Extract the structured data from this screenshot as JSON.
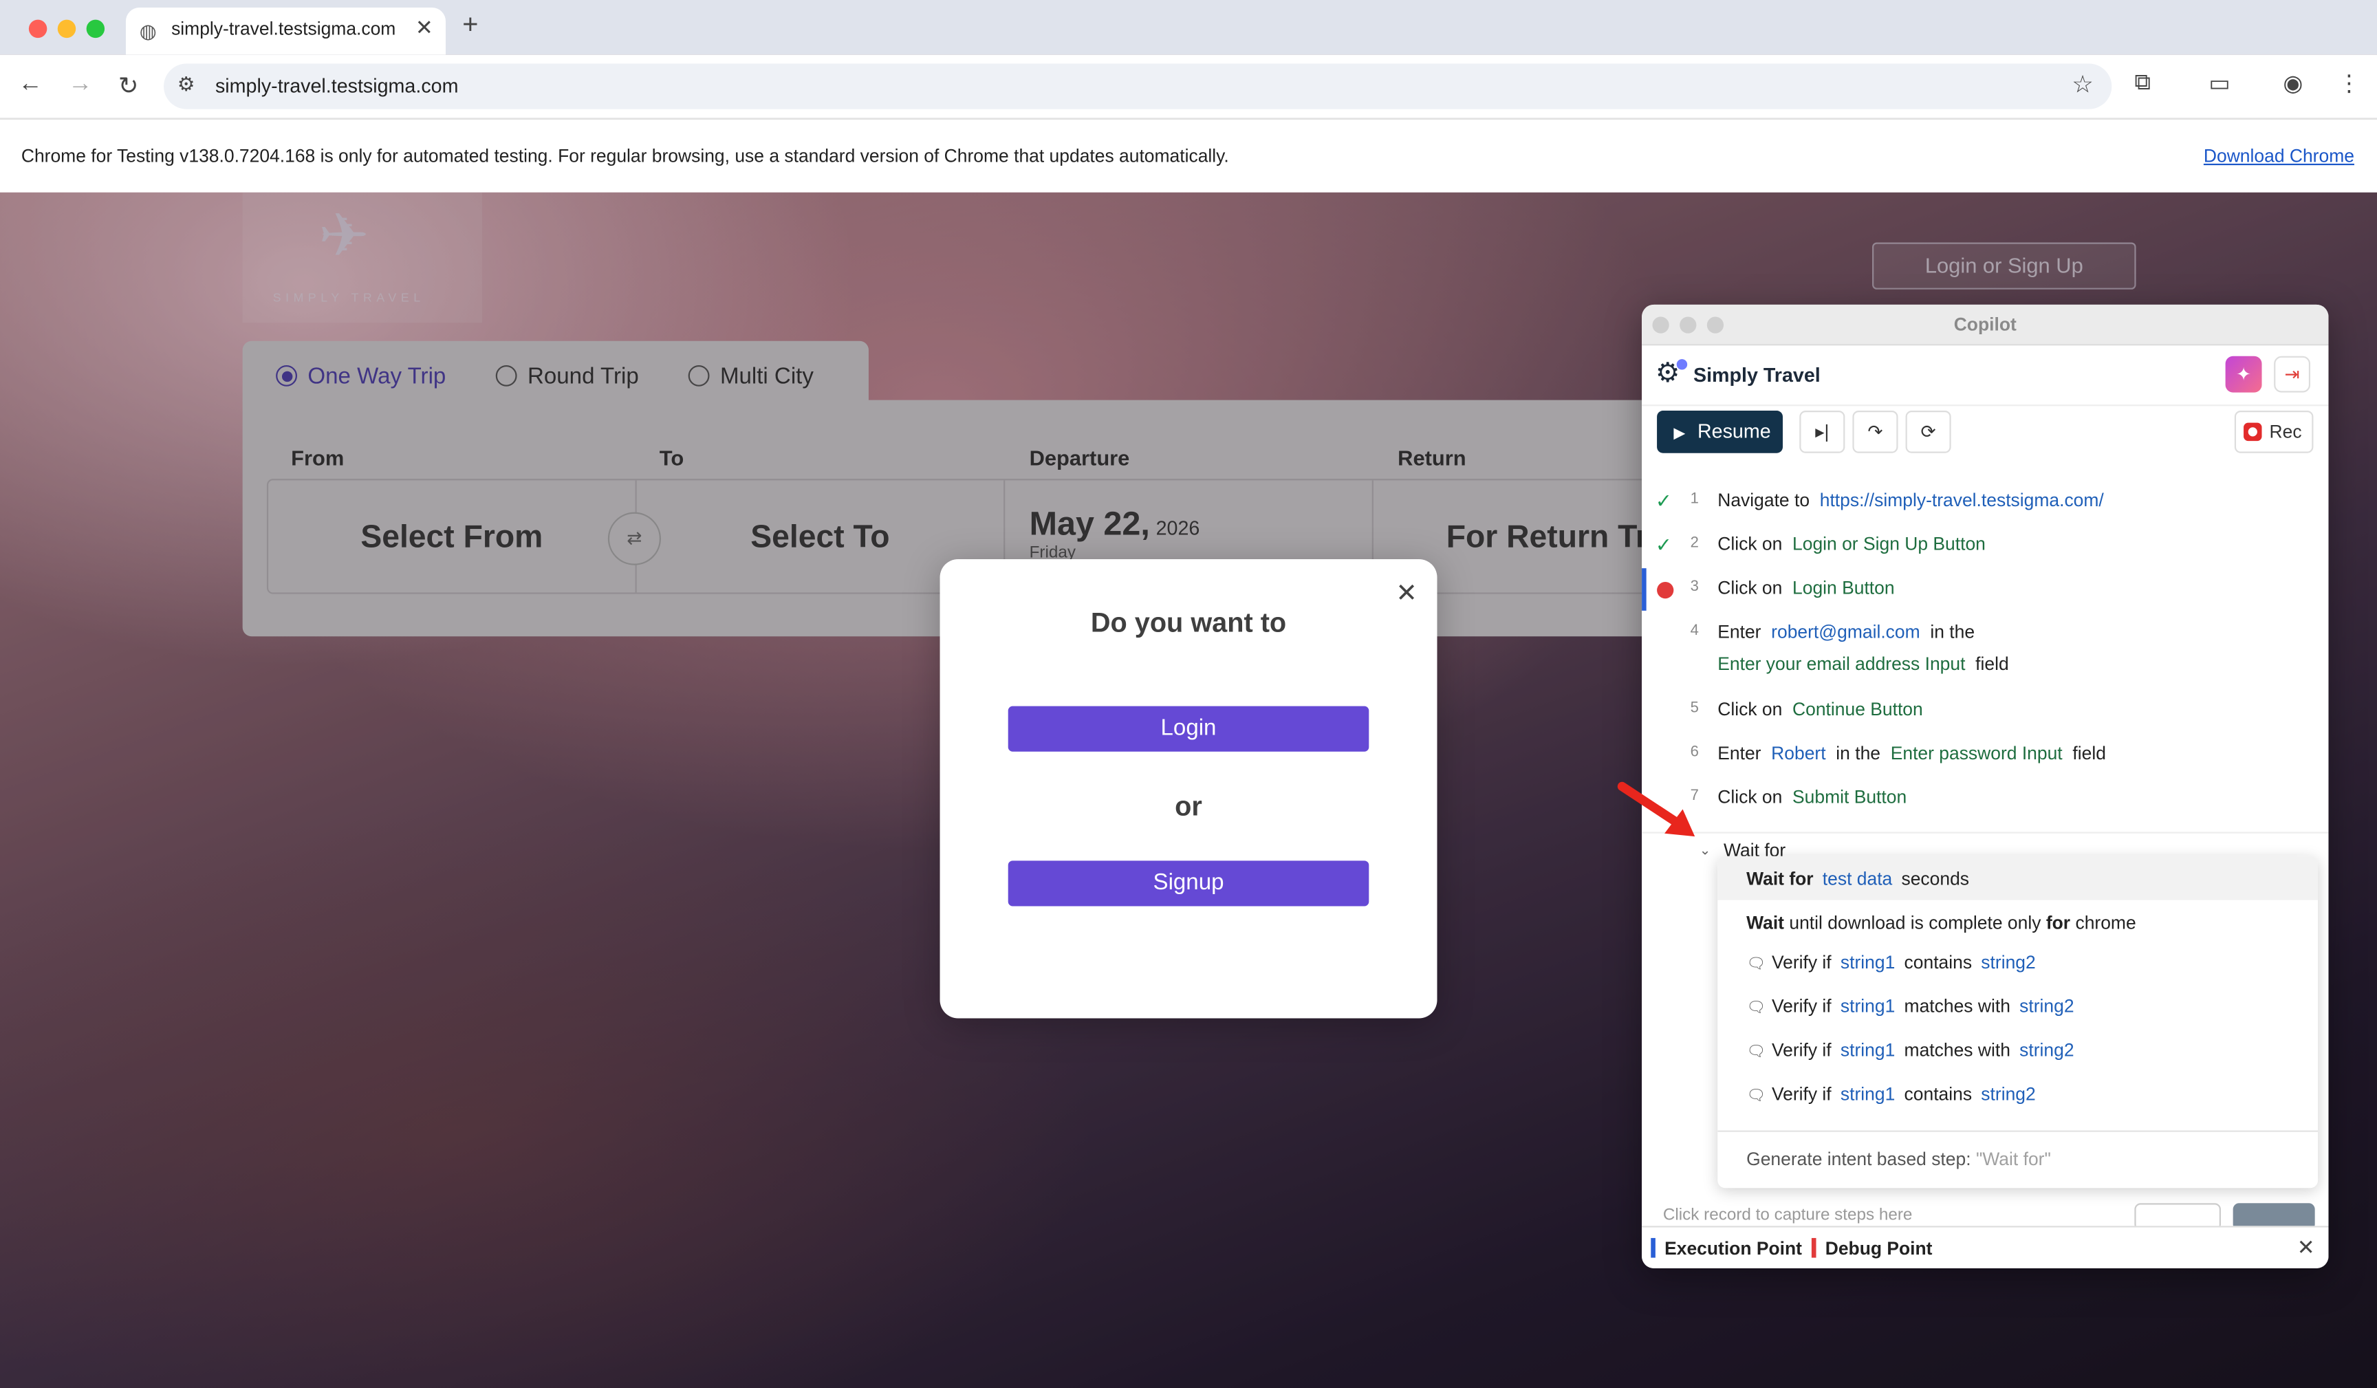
{
  "browser": {
    "tab_title": "simply-travel.testsigma.com",
    "url": "simply-travel.testsigma.com",
    "info_message": "Chrome for Testing v138.0.7204.168 is only for automated testing. For regular browsing, use a standard version of Chrome that updates automatically.",
    "download_link": "Download Chrome"
  },
  "site": {
    "logo_text": "SIMPLY TRAVEL",
    "header_button": "Login or Sign Up",
    "trip_types": [
      "One Way Trip",
      "Round Trip",
      "Multi City"
    ],
    "selected_trip": "One Way Trip",
    "labels": {
      "from": "From",
      "to": "To",
      "departure": "Departure",
      "return": "Return"
    },
    "from_value": "Select From",
    "to_value": "Select To",
    "departure_date": "May 22,",
    "departure_year": "2026",
    "departure_dow": "Friday",
    "return_value": "For Return Trip"
  },
  "modal": {
    "title": "Do you want to",
    "login": "Login",
    "or": "or",
    "signup": "Signup"
  },
  "copilot": {
    "window_title": "Copilot",
    "project": "Simply Travel",
    "resume": "Resume",
    "rec": "Rec",
    "steps": [
      {
        "n": "1",
        "status": "done",
        "parts": [
          "Navigate to",
          "https://simply-travel.testsigma.com/"
        ]
      },
      {
        "n": "2",
        "status": "done",
        "parts": [
          "Click on",
          "Login or Sign Up Button"
        ]
      },
      {
        "n": "3",
        "status": "breakpoint",
        "parts": [
          "Click on",
          "Login Button"
        ]
      },
      {
        "n": "4",
        "status": "pending",
        "parts": [
          "Enter",
          "robert@gmail.com",
          "in the",
          "Enter your email address Input",
          "field"
        ]
      },
      {
        "n": "5",
        "status": "pending",
        "parts": [
          "Click on",
          "Continue Button"
        ]
      },
      {
        "n": "6",
        "status": "pending",
        "parts": [
          "Enter",
          "Robert",
          "in the",
          "Enter password Input",
          "field"
        ]
      },
      {
        "n": "7",
        "status": "pending",
        "parts": [
          "Click on",
          "Submit Button"
        ]
      }
    ],
    "input_text": "Wait for",
    "suggestions": [
      {
        "a": "Wait for",
        "b": "test data",
        "c": "seconds"
      },
      {
        "a": "Wait",
        "b": "until download is complete only",
        "c": "for",
        "d": "chrome"
      },
      {
        "a": "Verify if",
        "b": "string1",
        "c": "contains",
        "d": "string2"
      },
      {
        "a": "Verify if",
        "b": "string1",
        "c": "matches with",
        "d": "string2"
      },
      {
        "a": "Verify if",
        "b": "string1",
        "c": "matches with",
        "d": "string2"
      },
      {
        "a": "Verify if",
        "b": "string1",
        "c": "contains",
        "d": "string2"
      }
    ],
    "generate_label": "Generate intent based step:",
    "generate_query": "\"Wait for\"",
    "hint": "Click record to capture steps here",
    "legend_execution": "Execution Point",
    "legend_debug": "Debug Point",
    "colors": {
      "execution": "#2a5fd6",
      "debug": "#e13b3b",
      "keyword": "#1e6d3f",
      "link": "#1f5fb8"
    }
  }
}
